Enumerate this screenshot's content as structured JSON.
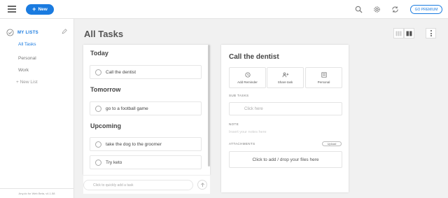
{
  "header": {
    "new_label": "New",
    "premium_label": "GO PREMIUM"
  },
  "sidebar": {
    "section_label": "MY LISTS",
    "items": [
      {
        "label": "All Tasks",
        "active": true
      },
      {
        "label": "Personal",
        "active": false
      },
      {
        "label": "Work",
        "active": false
      }
    ],
    "new_list_label": "+ New List",
    "footer": "Any.do for Web Beta, v4.1.58"
  },
  "main": {
    "title": "All Tasks",
    "groups": [
      {
        "title": "Today",
        "tasks": [
          "Call the dentist"
        ]
      },
      {
        "title": "Tomorrow",
        "tasks": [
          "go to a football game"
        ]
      },
      {
        "title": "Upcoming",
        "tasks": [
          "take the dog to the groomer",
          "Try keto"
        ]
      }
    ],
    "add_placeholder": "Click to quickly add a task"
  },
  "detail": {
    "title": "Call the dentist",
    "actions": [
      {
        "label": "Add Reminder",
        "icon": "clock-icon"
      },
      {
        "label": "Share task",
        "icon": "share-people-icon"
      },
      {
        "label": "Personal",
        "icon": "list-icon"
      }
    ],
    "subtasks_label": "SUB TASKS",
    "subtask_placeholder": "Click here",
    "note_label": "NOTE",
    "note_placeholder": "Insert your notes here",
    "attachments_label": "ATTACHMENTS",
    "upload_label": "Upload",
    "dropzone_text": "Click to add / drop your files here"
  },
  "colors": {
    "accent": "#1a7be0",
    "background": "#f1f1f1"
  }
}
